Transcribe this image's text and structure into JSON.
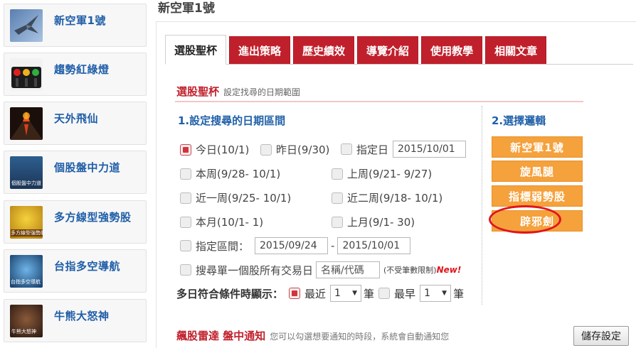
{
  "sidebar": {
    "items": [
      {
        "label": "新空軍1號",
        "thumb": "jet-icon"
      },
      {
        "label": "趨勢紅綠燈",
        "thumb": "traffic-light-icon"
      },
      {
        "label": "天外飛仙",
        "thumb": "volcano-icon"
      },
      {
        "label": "個股盤中力道",
        "thumb": "stock-power-icon",
        "thumb_text": "個股盤中力道"
      },
      {
        "label": "多方線型強勢股",
        "thumb": "bull-line-icon",
        "thumb_text": "多方線型強勢股"
      },
      {
        "label": "台指多空導航",
        "thumb": "navigation-icon",
        "thumb_text": "台指多空導航"
      },
      {
        "label": "牛熊大怒神",
        "thumb": "roulette-icon",
        "thumb_text": "牛熊大怒神"
      }
    ]
  },
  "page_title": "新空軍1號",
  "tabs": [
    "選股聖杯",
    "進出策略",
    "歷史績效",
    "導覽介紹",
    "使用教學",
    "相關文章"
  ],
  "active_tab": 0,
  "section": {
    "title": "選股聖杯",
    "subtitle": "設定找尋的日期範圍"
  },
  "date_range": {
    "title": "1.設定搜尋的日期區間",
    "today": "今日(10/1)",
    "yesterday": "昨日(9/30)",
    "specific_day": "指定日",
    "specific_day_value": "2015/10/01",
    "this_week": "本周(9/28- 10/1)",
    "last_week": "上周(9/21- 9/27)",
    "recent_week": "近一周(9/25- 10/1)",
    "recent_two_weeks": "近二周(9/18- 10/1)",
    "this_month": "本月(10/1- 1)",
    "last_month": "上月(9/1- 30)",
    "range_label": "指定區間：",
    "range_from": "2015/09/24",
    "range_dash": "-",
    "range_to": "2015/10/01",
    "single_stock": "搜尋單一個股所有交易日",
    "stock_placeholder": "名稱/代碼",
    "no_limit": "(不受筆數限制)",
    "new_badge": "New!",
    "multi_label": "多日符合條件時顯示：",
    "latest": "最近",
    "latest_value": "1",
    "earliest": "最早",
    "earliest_value": "1",
    "unit": "筆"
  },
  "logic": {
    "title": "2.選擇邏輯",
    "buttons": [
      "新空軍1號",
      "旋風腿",
      "指標弱勢股",
      "辟邪劍"
    ]
  },
  "notify": {
    "title": "飆股雷達 盤中通知",
    "subtitle": "您可以勾選想要通知的時段，系統會自動通知您"
  },
  "save_label": "儲存設定",
  "colors": {
    "accent_red": "#c0202c",
    "link_blue": "#1f5ea8",
    "logic_orange": "#f5a13c",
    "highlight_ellipse": "#e0141c"
  }
}
